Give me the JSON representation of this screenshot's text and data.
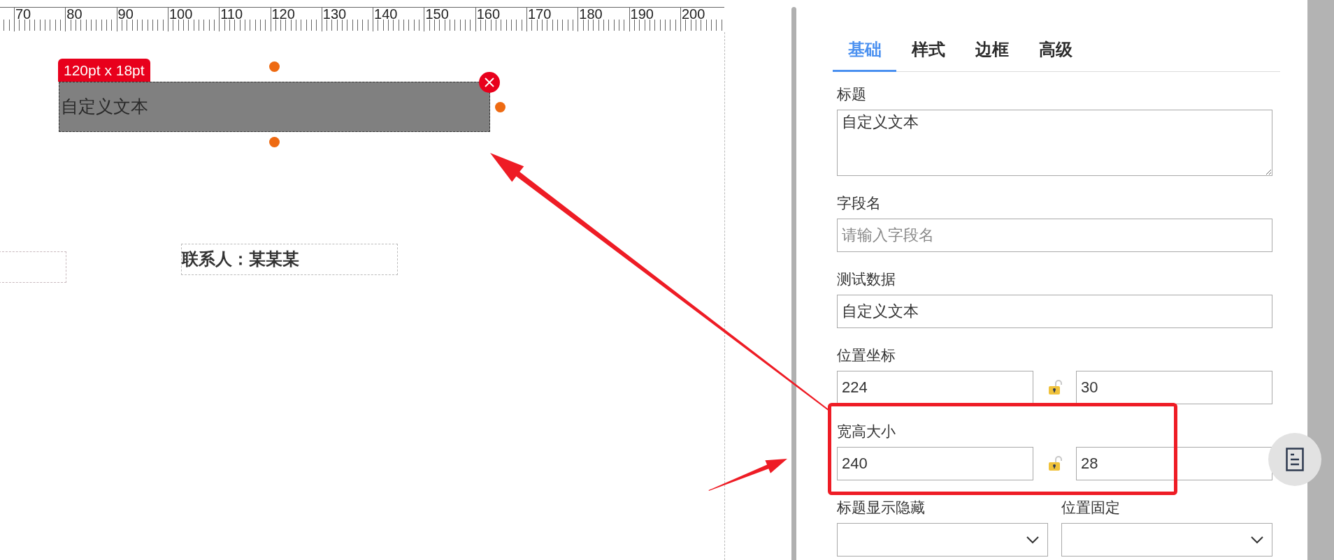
{
  "ruler": {
    "labels": [
      "70",
      "80",
      "90",
      "100",
      "110",
      "120",
      "130",
      "140",
      "150",
      "160",
      "170",
      "180",
      "190",
      "200"
    ]
  },
  "canvas": {
    "selected_element": {
      "size_tag": "120pt x 18pt",
      "text": "自定义文本"
    },
    "contact_text": "联系人：某某某"
  },
  "tabs": [
    {
      "label": "基础",
      "selected": true
    },
    {
      "label": "样式",
      "selected": false
    },
    {
      "label": "边框",
      "selected": false
    },
    {
      "label": "高级",
      "selected": false
    }
  ],
  "form": [
    {
      "kind": "textarea",
      "label": "标题",
      "value": "自定义文本"
    },
    {
      "kind": "text",
      "label": "字段名",
      "placeholder": "请输入字段名"
    },
    {
      "kind": "text",
      "label": "测试数据",
      "value": "自定义文本"
    },
    {
      "kind": "pair",
      "label": "位置坐标",
      "values": [
        "224",
        "30"
      ],
      "locked": false
    },
    {
      "kind": "pair",
      "label": "宽高大小",
      "values": [
        "240",
        "28"
      ],
      "locked": false
    },
    {
      "kind": "selects",
      "labels": [
        "标题显示隐藏",
        "位置固定"
      ]
    }
  ]
}
